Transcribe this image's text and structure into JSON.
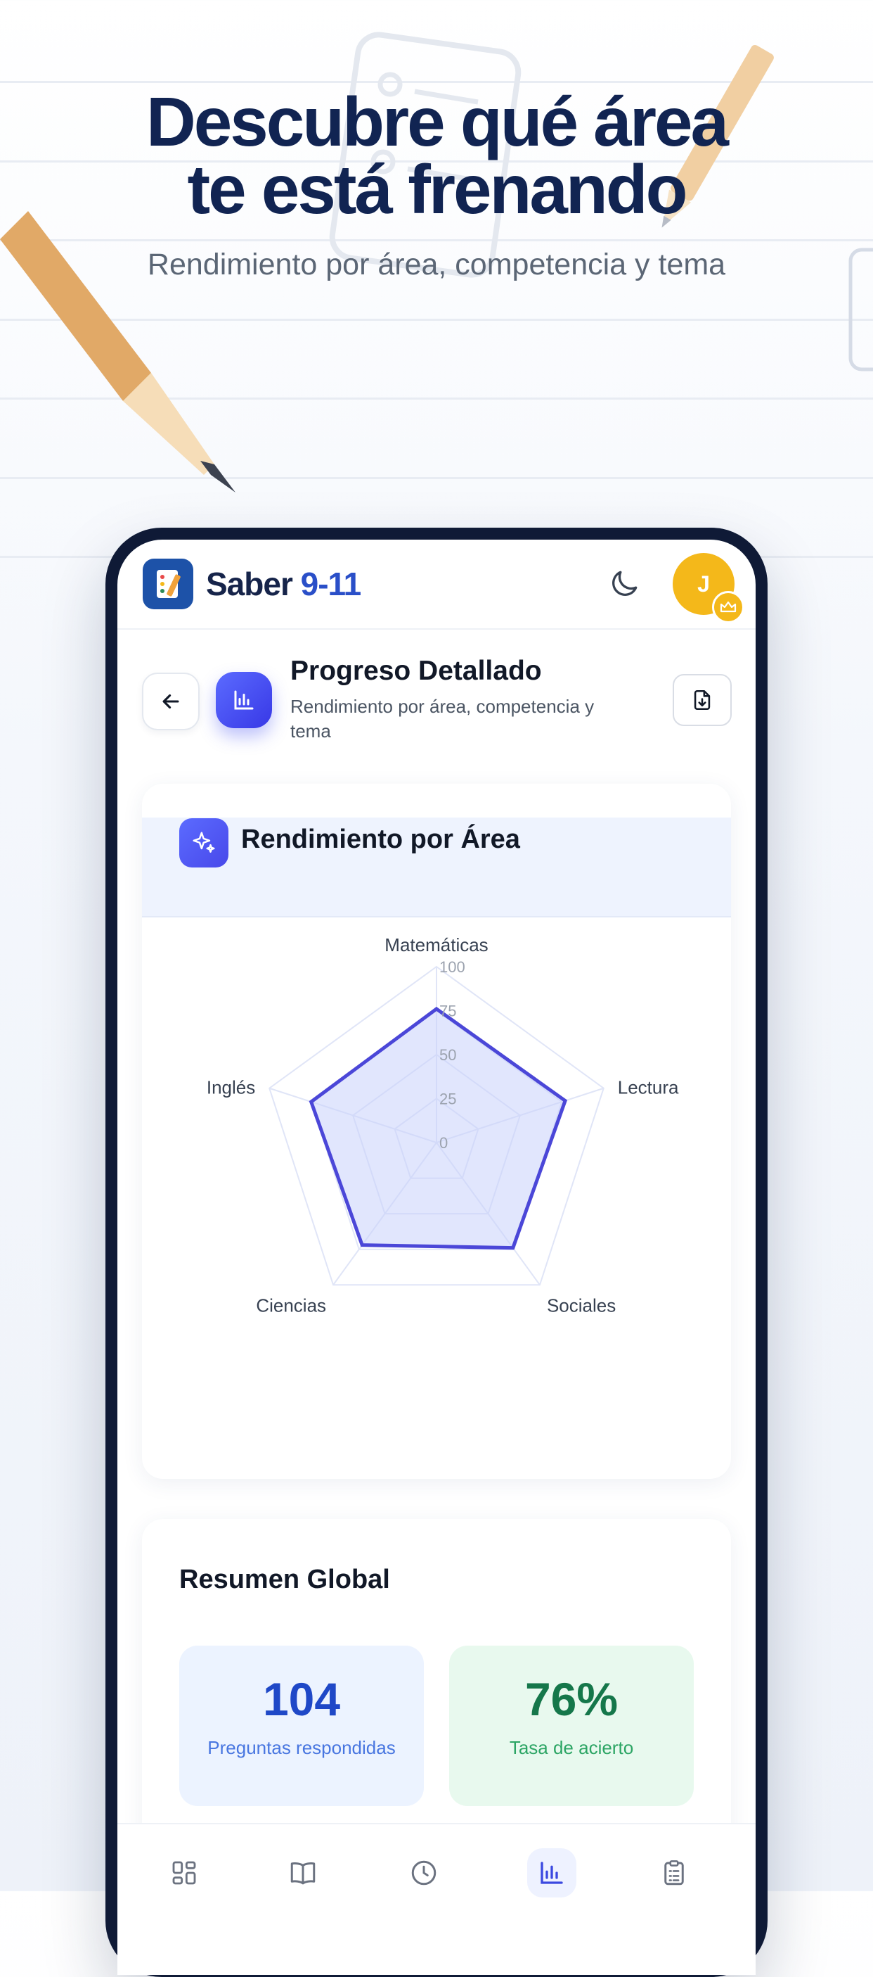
{
  "hero": {
    "title_line1": "Descubre qué área",
    "title_line2": "te está frenando",
    "subtitle": "Rendimiento por área, competencia y tema"
  },
  "app": {
    "name_part1": "Saber ",
    "name_part2": "9-11",
    "avatar_initial": "J"
  },
  "header": {
    "title": "Progreso Detallado",
    "subtitle": "Rendimiento por área, competencia y tema"
  },
  "radar_card": {
    "title": "Rendimiento por Área"
  },
  "chart_data": {
    "type": "radar",
    "categories": [
      "Matemáticas",
      "Lectura",
      "Sociales",
      "Ciencias",
      "Inglés"
    ],
    "values": [
      76,
      77,
      74,
      72,
      75
    ],
    "ticks": [
      "0",
      "25",
      "50",
      "75",
      "100"
    ],
    "range": [
      0,
      100
    ],
    "colors": {
      "line": "#4b47d8",
      "fill": "#c9d2fb",
      "grid": "#e0e5f7"
    }
  },
  "summary": {
    "title": "Resumen Global",
    "stats": [
      {
        "value": "104",
        "label": "Preguntas respondidas"
      },
      {
        "value": "76%",
        "label": "Tasa de acierto"
      }
    ]
  },
  "nav": {
    "items": [
      "dashboard-icon",
      "book-icon",
      "clock-icon",
      "chart-icon",
      "clipboard-icon"
    ],
    "active": "chart-icon"
  }
}
